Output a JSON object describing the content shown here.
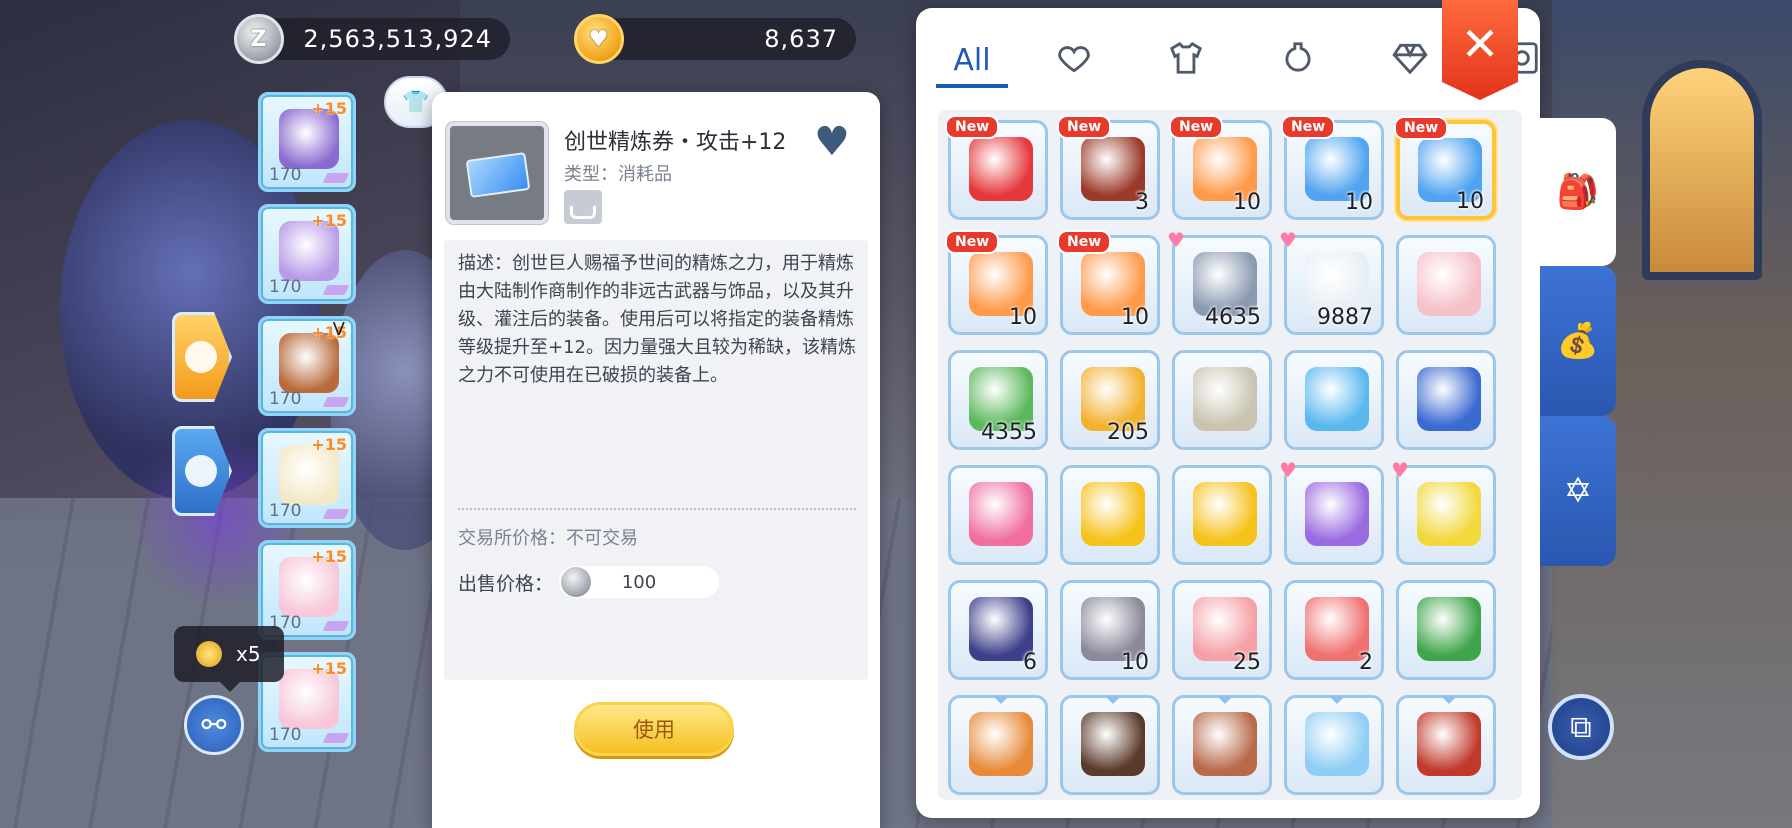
{
  "currency": {
    "zeny": "2,563,513,924",
    "diamond": "8,637"
  },
  "equipment": [
    {
      "plus": "+15",
      "level": "170",
      "icon": "fish-mask-icon",
      "v": ""
    },
    {
      "plus": "+15",
      "level": "170",
      "icon": "bird-armor-icon",
      "v": ""
    },
    {
      "plus": "+15",
      "level": "170",
      "icon": "brown-cloak-icon",
      "v": "V"
    },
    {
      "plus": "+15",
      "level": "170",
      "icon": "angel-shoes-icon",
      "v": ""
    },
    {
      "plus": "+15",
      "level": "170",
      "icon": "flower-branch-icon",
      "v": ""
    },
    {
      "plus": "+15",
      "level": "170",
      "icon": "flower-branch-icon",
      "v": ""
    }
  ],
  "reward_tip": {
    "count": "x5"
  },
  "detail": {
    "name": "创世精炼券・攻击+12",
    "type_label": "类型：消耗品",
    "description": "描述：创世巨人赐福予世间的精炼之力，用于精炼由大陆制作商制作的非远古武器与饰品，以及其升级、灌注后的装备。使用后可以将指定的装备精炼等级提升至+12。因力量强大且较为稀缺，该精炼之力不可使用在已破损的装备上。",
    "trade_price": "交易所价格：不可交易",
    "sell_label": "出售价格：",
    "sell_value": "100",
    "use_button": "使用"
  },
  "inventory": {
    "tabs": [
      {
        "label": "All",
        "icon": "all-text",
        "active": true
      },
      {
        "label": "",
        "icon": "heart-icon",
        "active": false
      },
      {
        "label": "",
        "icon": "shirt-icon",
        "active": false
      },
      {
        "label": "",
        "icon": "potion-icon",
        "active": false
      },
      {
        "label": "",
        "icon": "diamond-icon",
        "active": false
      },
      {
        "label": "",
        "icon": "card-icon",
        "active": false
      }
    ],
    "close_label": "✕",
    "new_badge": "New",
    "items": [
      {
        "icon": "red-envelope-icon",
        "count": "",
        "new": true,
        "fav": false,
        "color": "#e6373a"
      },
      {
        "icon": "treasure-chest-icon",
        "count": "3",
        "new": true,
        "fav": false,
        "color": "#9b3a2a"
      },
      {
        "icon": "orange-ticket-icon",
        "count": "10",
        "new": true,
        "fav": false,
        "color": "#ff9a4a"
      },
      {
        "icon": "blue-ticket-icon",
        "count": "10",
        "new": true,
        "fav": false,
        "color": "#4fa3f0"
      },
      {
        "icon": "blue-ticket-icon",
        "count": "10",
        "new": true,
        "fav": false,
        "color": "#4fa3f0",
        "selected": true
      },
      {
        "icon": "orange-ticket-icon",
        "count": "10",
        "new": true,
        "fav": false,
        "color": "#ff9a4a"
      },
      {
        "icon": "orange-ticket-icon",
        "count": "10",
        "new": true,
        "fav": false,
        "color": "#ff9a4a"
      },
      {
        "icon": "butterfly-wing-icon",
        "count": "4635",
        "new": false,
        "fav": true,
        "color": "#8a9ab0"
      },
      {
        "icon": "feather-icon",
        "count": "9887",
        "new": false,
        "fav": true,
        "color": "#e8eef6"
      },
      {
        "icon": "cake-icon",
        "count": "",
        "new": false,
        "fav": false,
        "color": "#f5c0c8"
      },
      {
        "icon": "herb-icon",
        "count": "4355",
        "new": false,
        "fav": false,
        "color": "#5cb85c"
      },
      {
        "icon": "golden-chest-icon",
        "count": "205",
        "new": false,
        "fav": false,
        "color": "#f2b230"
      },
      {
        "icon": "hammer-icon",
        "count": "",
        "new": false,
        "fav": false,
        "color": "#c9c3b0"
      },
      {
        "icon": "crystal-ball-icon",
        "count": "",
        "new": false,
        "fav": false,
        "color": "#5bb8ef"
      },
      {
        "icon": "gift-box-icon",
        "count": "",
        "new": false,
        "fav": false,
        "color": "#3b6ad1"
      },
      {
        "icon": "pink-scroll-icon",
        "count": "",
        "new": false,
        "fav": false,
        "color": "#f06fa0"
      },
      {
        "icon": "gold-star-coin-icon",
        "count": "",
        "new": false,
        "fav": false,
        "color": "#f6c21c"
      },
      {
        "icon": "gold-question-coin-icon",
        "count": "",
        "new": false,
        "fav": false,
        "color": "#f6c21c"
      },
      {
        "icon": "sale-card-icon",
        "count": "",
        "new": false,
        "fav": true,
        "color": "#9a6ae0"
      },
      {
        "icon": "gold-ticket-icon",
        "count": "",
        "new": false,
        "fav": true,
        "color": "#f2d83a"
      },
      {
        "icon": "dark-chest-icon",
        "count": "6",
        "new": false,
        "fav": false,
        "color": "#3d3f8a"
      },
      {
        "icon": "ore-icon",
        "count": "10",
        "new": false,
        "fav": false,
        "color": "#8a8a9c"
      },
      {
        "icon": "pink-box-icon",
        "count": "25",
        "new": false,
        "fav": false,
        "color": "#f4a0a6"
      },
      {
        "icon": "medkit-icon",
        "count": "2",
        "new": false,
        "fav": false,
        "color": "#f07070"
      },
      {
        "icon": "green-book-icon",
        "count": "",
        "new": false,
        "fav": false,
        "color": "#3fa54a"
      },
      {
        "icon": "pouch-icon",
        "count": "",
        "new": false,
        "fav": false,
        "color": "#e88a3a",
        "tri": true
      },
      {
        "icon": "spell-book-icon",
        "count": "",
        "new": false,
        "fav": false,
        "color": "#5a3a2a",
        "tri": true
      },
      {
        "icon": "pet-egg-icon",
        "count": "",
        "new": false,
        "fav": false,
        "color": "#b86a4a",
        "tri": true
      },
      {
        "icon": "ice-box-icon",
        "count": "",
        "new": false,
        "fav": false,
        "color": "#8ecdf5",
        "tri": true
      },
      {
        "icon": "red-book-icon",
        "count": "",
        "new": false,
        "fav": false,
        "color": "#c0392b",
        "tri": true
      }
    ]
  },
  "side_tabs": [
    "backpack-icon",
    "zeny-bag-icon",
    "magic-circle-icon"
  ]
}
